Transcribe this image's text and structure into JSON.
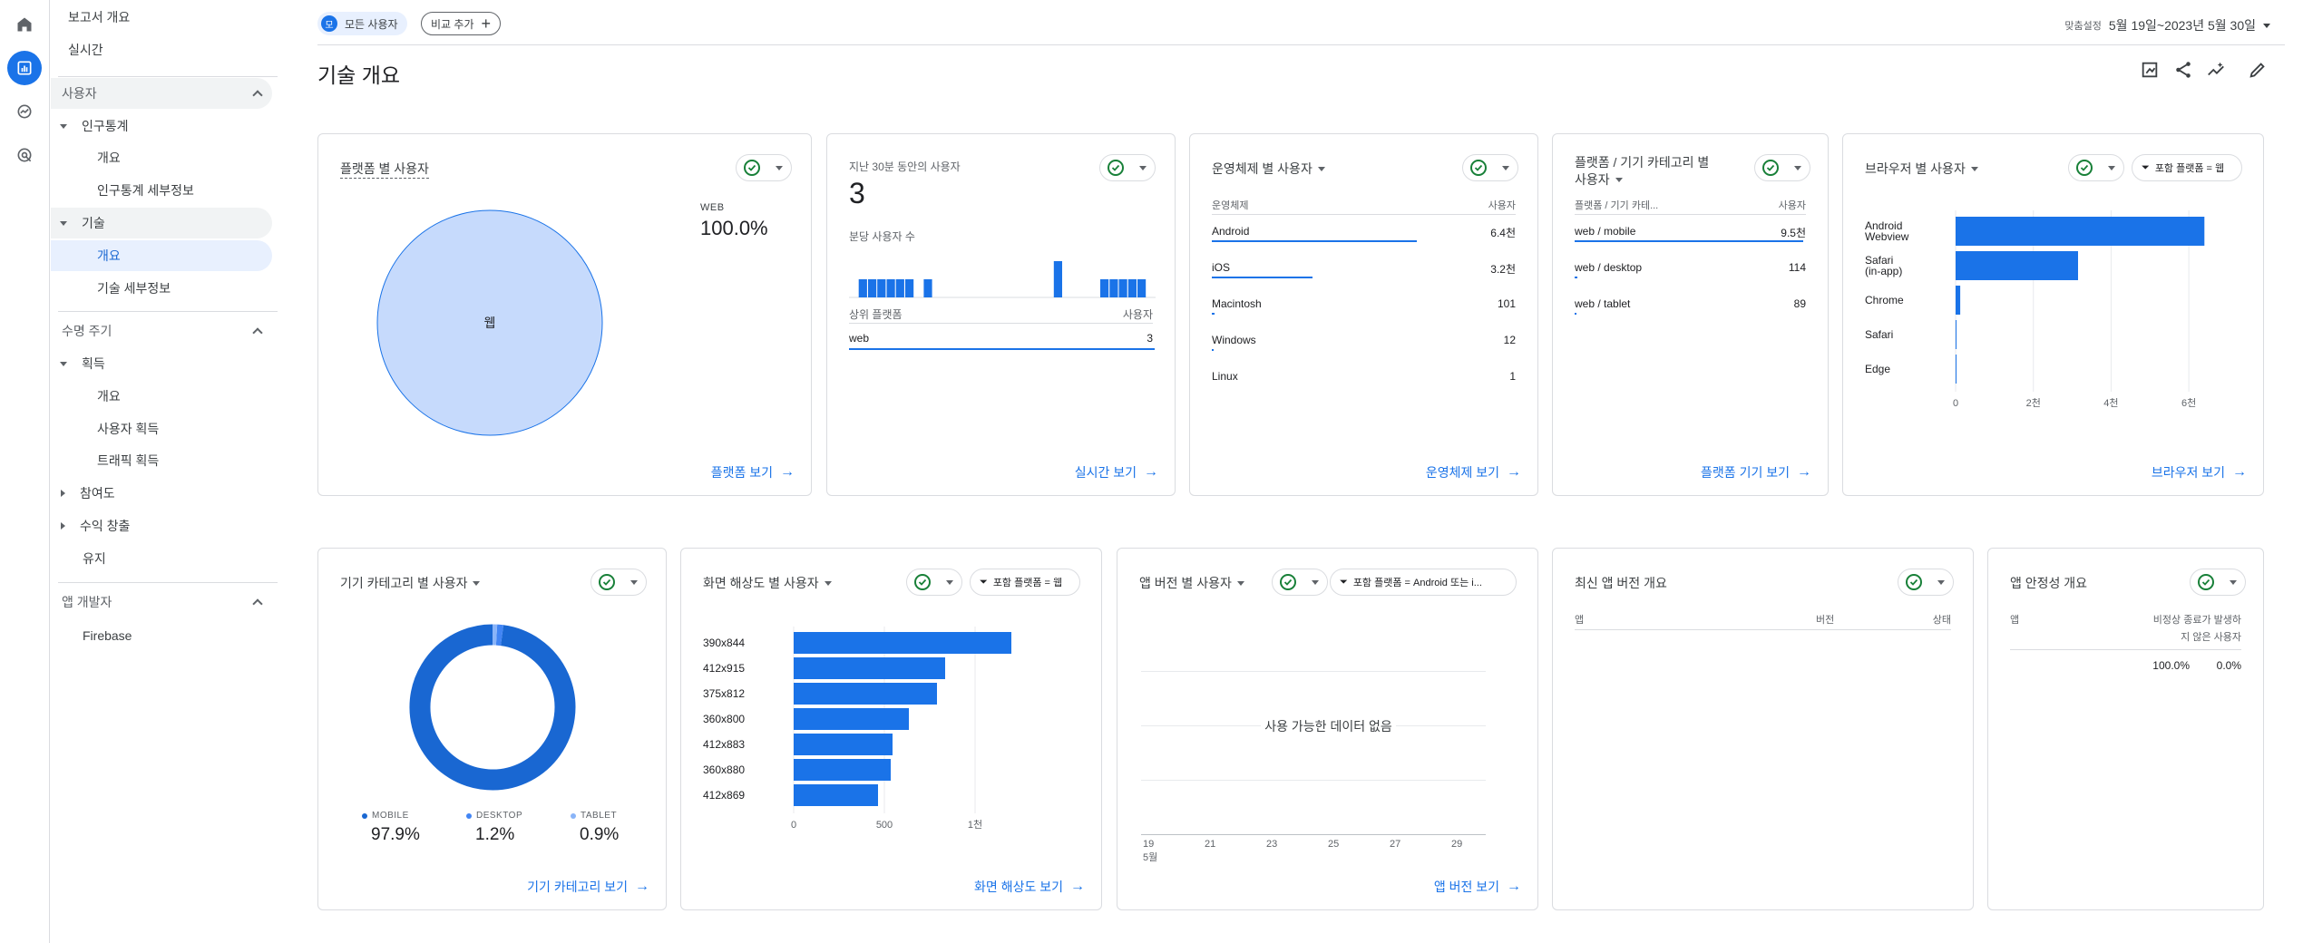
{
  "rail": {
    "icons": [
      "home-icon",
      "reports-icon",
      "explore-icon",
      "advertising-icon"
    ]
  },
  "nav": {
    "report_overview": "보고서 개요",
    "realtime": "실시간",
    "section_users": "사용자",
    "demographics": "인구통계",
    "demographics_overview": "개요",
    "demographics_details": "인구통계 세부정보",
    "tech": "기술",
    "tech_overview": "개요",
    "tech_details": "기술 세부정보",
    "section_lifecycle": "수명 주기",
    "acquisition": "획득",
    "acquisition_overview": "개요",
    "user_acquisition": "사용자 획득",
    "traffic_acquisition": "트래픽 획득",
    "engagement": "참여도",
    "monetization": "수익 창출",
    "retention": "유지",
    "section_app_dev": "앱 개발자",
    "firebase": "Firebase"
  },
  "topbar": {
    "segment_avatar": "모",
    "segment_label": "모든 사용자",
    "compare_label": "비교 추가",
    "date_prefix": "맞춤설정",
    "date_range": "5월 19일~2023년 5월 30일"
  },
  "page_title": "기술 개요",
  "colors": {
    "accent": "#1a73e8",
    "bar": "#1a73e8",
    "pie_fill": "#c6dafc",
    "check": "#188038"
  },
  "platform_card": {
    "title": "플랫폼 별 사용자",
    "legend_label": "WEB",
    "legend_value": "100.0%",
    "pie_label": "웹",
    "link": "플랫폼 보기",
    "chart_data": {
      "type": "pie",
      "categories": [
        "웹"
      ],
      "values": [
        100.0
      ]
    }
  },
  "realtime_card": {
    "title": "지난 30분 동안의 사용자",
    "value": "3",
    "subtitle": "분당 사용자 수",
    "col1": "상위 플랫폼",
    "col2": "사용자",
    "row_label": "web",
    "row_value": "3",
    "link": "실시간 보기",
    "chart_data": {
      "type": "bar",
      "values": [
        0,
        1,
        1,
        1,
        1,
        1,
        1,
        0,
        1,
        0,
        0,
        0,
        0,
        0,
        0,
        0,
        0,
        0,
        0,
        0,
        0,
        0,
        2,
        0,
        0,
        0,
        0,
        1,
        1,
        1,
        1,
        1,
        0
      ]
    }
  },
  "os_card": {
    "title": "운영체제 별 사용자",
    "col1": "운영체제",
    "col2": "사용자",
    "rows": [
      {
        "label": "Android",
        "value": "6.4천",
        "share": 0.67
      },
      {
        "label": "iOS",
        "value": "3.2천",
        "share": 0.33
      },
      {
        "label": "Macintosh",
        "value": "101",
        "share": 0.01
      },
      {
        "label": "Windows",
        "value": "12",
        "share": 0.001
      },
      {
        "label": "Linux",
        "value": "1",
        "share": 0.0
      }
    ],
    "link": "운영체제 보기"
  },
  "device_platform_card": {
    "title_line1": "플랫폼 / 기기 카테고리 별",
    "title_line2": "사용자",
    "col1": "플랫폼 / 기기 카테...",
    "col2": "사용자",
    "rows": [
      {
        "label": "web / mobile",
        "value": "9.5천",
        "share": 0.98
      },
      {
        "label": "web / desktop",
        "value": "114",
        "share": 0.012
      },
      {
        "label": "web / tablet",
        "value": "89",
        "share": 0.009
      }
    ],
    "link": "플랫폼 기기 보기"
  },
  "browser_card": {
    "title": "브라우저 별 사용자",
    "filter_label": "포함 플랫폼 = 웹",
    "link": "브라우저 보기",
    "chart_data": {
      "type": "bar",
      "categories": [
        "Android Webview",
        "Safari (in-app)",
        "Chrome",
        "Safari",
        "Edge"
      ],
      "values": [
        6400,
        3150,
        120,
        15,
        5
      ],
      "xlim": [
        0,
        7000
      ],
      "x_ticks": [
        "0",
        "2천",
        "4천",
        "6천"
      ],
      "x_tick_values": [
        0,
        2000,
        4000,
        6000
      ]
    }
  },
  "device_category_card": {
    "title": "기기 카테고리 별 사용자",
    "legend": [
      {
        "label": "MOBILE",
        "value": "97.9%",
        "color": "#1967d2"
      },
      {
        "label": "DESKTOP",
        "value": "1.2%",
        "color": "#4285f4"
      },
      {
        "label": "TABLET",
        "value": "0.9%",
        "color": "#8ab4f8"
      }
    ],
    "link": "기기 카테고리 보기",
    "chart_data": {
      "type": "pie",
      "categories": [
        "MOBILE",
        "DESKTOP",
        "TABLET"
      ],
      "values": [
        97.9,
        1.2,
        0.9
      ]
    }
  },
  "resolution_card": {
    "title": "화면 해상도 별 사용자",
    "filter_label": "포함 플랫폼 = 웹",
    "link": "화면 해상도 보기",
    "chart_data": {
      "type": "bar",
      "categories": [
        "390x844",
        "412x915",
        "375x812",
        "360x800",
        "412x883",
        "360x880",
        "412x869"
      ],
      "values": [
        1200,
        835,
        790,
        635,
        545,
        535,
        465
      ],
      "xlim": [
        0,
        1500
      ],
      "x_ticks": [
        "0",
        "500",
        "1천"
      ],
      "x_tick_values": [
        0,
        500,
        1000
      ]
    }
  },
  "app_version_card": {
    "title": "앱 버전 별 사용자",
    "filter_label": "포함 플랫폼 = Android 또는 i...",
    "empty_message": "사용 가능한 데이터 없음",
    "x_ticks": [
      "19",
      "21",
      "23",
      "25",
      "27",
      "29"
    ],
    "x_month": "5월",
    "link": "앱 버전 보기"
  },
  "latest_app_card": {
    "title": "최신 앱 버전 개요",
    "col1": "앱",
    "col2": "버전",
    "col3": "상태"
  },
  "stability_card": {
    "title": "앱 안정성 개요",
    "col1": "앱",
    "col2_line1": "비정상 종료가 발생하",
    "col2_line2": "지 않은 사용자",
    "val1": "100.0%",
    "val2": "0.0%"
  }
}
